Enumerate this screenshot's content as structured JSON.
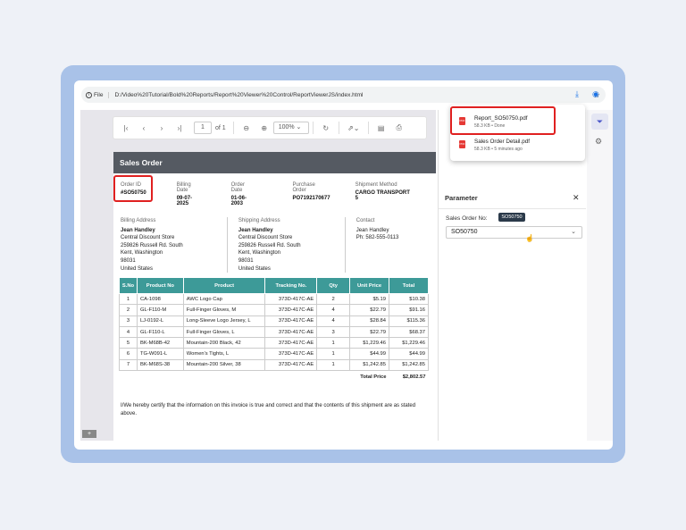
{
  "browser": {
    "site_info": "File",
    "url": "D:/Video%20Tutorial/Bold%20Reports/Report%20Viewer%20Control/ReportViewerJS/index.html"
  },
  "downloads": [
    {
      "name": "Report_SO50750.pdf",
      "status": "58.3 KB • Done"
    },
    {
      "name": "Sales Order Detail.pdf",
      "status": "58.3 KB • 5 minutes ago"
    }
  ],
  "toolbar": {
    "page": "1",
    "of": "of 1",
    "zoom": "100%"
  },
  "report": {
    "title": "Sales Order",
    "meta": [
      {
        "label": "Order ID",
        "value": "#SO50750"
      },
      {
        "label": "Billing Date",
        "value": "09-07-2025"
      },
      {
        "label": "Order Date",
        "value": "01-06-2003"
      },
      {
        "label": "Purchase Order",
        "value": "PO7192170677"
      },
      {
        "label": "Shipment Method",
        "value": "CARGO TRANSPORT 5"
      }
    ],
    "billing": {
      "label": "Billing Address",
      "name": "Jean Handley",
      "l1": "Central Discount Store",
      "l2": "259826 Russell Rd. South",
      "l3": "Kent, Washington",
      "l4": "98031",
      "l5": "United States"
    },
    "shipping": {
      "label": "Shipping Address",
      "name": "Jean Handley",
      "l1": "Central Discount Store",
      "l2": "259826 Russell Rd. South",
      "l3": "Kent, Washington",
      "l4": "98031",
      "l5": "United States"
    },
    "contact": {
      "label": "Contact",
      "name": "Jean Handley",
      "phone": "Ph: 582-555-0113"
    },
    "columns": [
      "S.No",
      "Product No",
      "Product",
      "Tracking No.",
      "Qty",
      "Unit Price",
      "Total"
    ],
    "rows": [
      [
        "1",
        "CA-1098",
        "AWC Logo Cap",
        "373D-417C-AE",
        "2",
        "$5.19",
        "$10.38"
      ],
      [
        "2",
        "GL-F110-M",
        "Full-Finger Gloves, M",
        "373D-417C-AE",
        "4",
        "$22.79",
        "$91.16"
      ],
      [
        "3",
        "LJ-0192-L",
        "Long-Sleeve Logo Jersey, L",
        "373D-417C-AE",
        "4",
        "$28.84",
        "$115.36"
      ],
      [
        "4",
        "GL-F110-L",
        "Full-Finger Gloves, L",
        "373D-417C-AE",
        "3",
        "$22.79",
        "$68.37"
      ],
      [
        "5",
        "BK-M68B-42",
        "Mountain-200 Black, 42",
        "373D-417C-AE",
        "1",
        "$1,229.46",
        "$1,229.46"
      ],
      [
        "6",
        "TG-W091-L",
        "Women's Tights, L",
        "373D-417C-AE",
        "1",
        "$44.99",
        "$44.99"
      ],
      [
        "7",
        "BK-M68S-38",
        "Mountain-200 Silver, 38",
        "373D-417C-AE",
        "1",
        "$1,242.85",
        "$1,242.85"
      ]
    ],
    "total_label": "Total Price",
    "total_value": "$2,802.57",
    "certification": "I/We hereby certify that the information on this invoice is true and correct and that the contents of this shipment are as stated above."
  },
  "parameter": {
    "title": "Parameter",
    "label": "Sales Order No:",
    "value": "SO50750",
    "tooltip": "SO50750"
  },
  "colors": {
    "header": "#555a62",
    "table_header": "#3d9a98",
    "highlight": "#e02020",
    "frame": "#a9c2e8"
  }
}
